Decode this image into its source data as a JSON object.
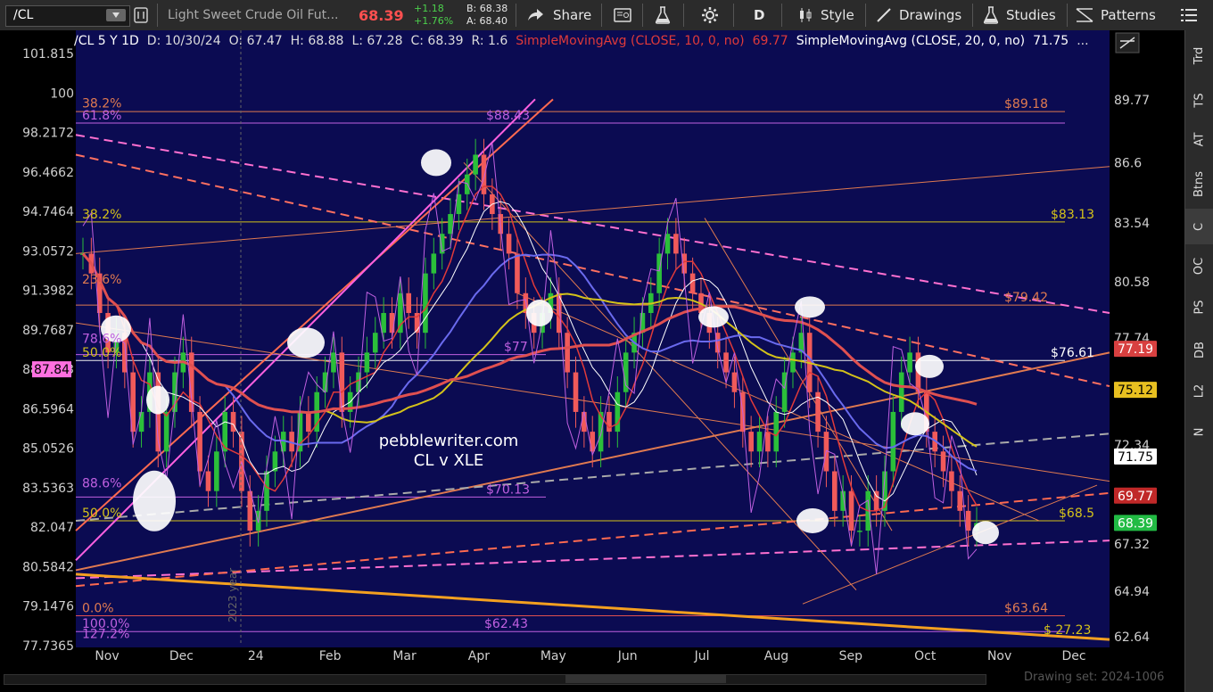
{
  "toolbar": {
    "symbol": "/CL",
    "description": "Light Sweet Crude Oil Fut...",
    "last": "68.39",
    "change": "+1.18",
    "change_pct": "+1.76%",
    "bid": "B: 68.38",
    "ask": "A: 68.40",
    "share": "Share",
    "timeframe": "D",
    "style": "Style",
    "drawings": "Drawings",
    "studies": "Studies",
    "patterns": "Patterns"
  },
  "header": {
    "title": "/CL 5 Y 1D",
    "date": "D: 10/30/24",
    "open": "O: 67.47",
    "high": "H: 68.88",
    "low": "L: 67.28",
    "close": "C: 68.39",
    "range": "R: 1.6",
    "sma10": "SimpleMovingAvg (CLOSE, 10, 0, no)",
    "sma10_val": "69.77",
    "sma20": "SimpleMovingAvg (CLOSE, 20, 0, no)",
    "sma20_val": "71.75",
    "more": "..."
  },
  "right_tabs": [
    "Trd",
    "TS",
    "AT",
    "Btns",
    "C",
    "OC",
    "PS",
    "DB",
    "L2",
    "N"
  ],
  "active_tab": "C",
  "bottom": {
    "drawing_set": "Drawing set: 2024-1006"
  },
  "colors": {
    "bg": "#000000",
    "up": "#2bbf3a",
    "down": "#f05a5a",
    "sma10": "#e03a3a",
    "sma20": "#ffffff",
    "blue_ma": "#6a6aee",
    "yellow_ma": "#d4c21a",
    "red_ma": "#e05050",
    "xle": "#c060e0",
    "pink": "#ff70d0"
  },
  "chart_data": {
    "type": "line",
    "title": "/CL 5 Y 1D",
    "watermark": [
      "pebblewriter.com",
      "CL v XLE"
    ],
    "vertical_marker": "2023 year",
    "x_ticks": [
      "Nov",
      "Dec",
      "24",
      "Feb",
      "Mar",
      "Apr",
      "May",
      "Jun",
      "Jul",
      "Aug",
      "Sep",
      "Oct",
      "Nov",
      "Dec"
    ],
    "left_axis": {
      "ticks": [
        "101.815",
        "100",
        "98.2172",
        "96.4662",
        "94.7464",
        "93.0572",
        "91.3982",
        "89.7687",
        "88.1683",
        "86.5964",
        "85.0526",
        "83.5363",
        "82.047",
        "80.5842",
        "79.1476",
        "77.7365"
      ]
    },
    "right_axis": {
      "ticks": [
        "89.77",
        "86.6",
        "83.54",
        "80.58",
        "77.74",
        "75.12",
        "72.34",
        "69.77",
        "67.32",
        "64.94",
        "62.64"
      ],
      "range": [
        62.64,
        89.77
      ],
      "badges": [
        {
          "label": "77.19",
          "color": "#d84040"
        },
        {
          "label": "75.12",
          "color": "#e8c020"
        },
        {
          "label": "71.75",
          "color": "#ffffff"
        },
        {
          "label": "69.77",
          "color": "#c02828"
        },
        {
          "label": "68.39",
          "color": "#22bb44"
        }
      ]
    },
    "left_badge": {
      "label": "87.84",
      "color": "#ff70e0"
    },
    "price_labels": [
      "$89.18",
      "$88.43",
      "$83.13",
      "$79.42",
      "$76.61",
      "$77",
      "$70.13",
      "$68.5",
      "$63.64",
      "$62.43",
      "$ 27.23"
    ],
    "fib_labels": [
      "38.2%",
      "61.8%",
      "38.2%",
      "23.6%",
      "78.6%",
      "50.0%",
      "88.6%",
      "50.0%",
      "0.0%",
      "100.0%",
      "127.2%"
    ],
    "series": [
      {
        "name": "SimpleMovingAvg (CLOSE, 10, 0, no)",
        "last": 69.77
      },
      {
        "name": "SimpleMovingAvg (CLOSE, 20, 0, no)",
        "last": 71.75
      }
    ],
    "close_series": [
      82,
      81,
      79,
      77,
      78,
      76,
      73,
      74,
      76,
      72,
      74,
      76,
      77,
      74,
      71,
      70,
      72,
      74,
      73,
      70,
      68,
      69,
      71,
      72,
      73,
      72,
      74,
      73,
      75,
      76,
      77,
      74,
      75,
      76,
      77,
      78,
      79,
      78,
      80,
      79,
      78,
      81,
      82,
      83,
      84,
      85,
      86,
      87,
      85,
      84,
      83,
      82,
      80,
      79,
      78,
      79,
      80,
      78,
      76,
      74,
      73,
      72,
      74,
      73,
      75,
      77,
      78,
      79,
      80,
      82,
      83,
      82,
      81,
      80,
      79,
      78,
      77,
      76,
      75,
      73,
      72,
      73,
      72,
      74,
      76,
      77,
      78,
      75,
      73,
      71,
      69,
      70,
      68,
      68,
      70,
      69,
      71,
      74,
      76,
      77,
      75,
      73,
      72,
      71,
      70,
      69,
      68,
      68.39
    ],
    "chart_top_rel": 26,
    "chart_bottom_rel": 684
  }
}
